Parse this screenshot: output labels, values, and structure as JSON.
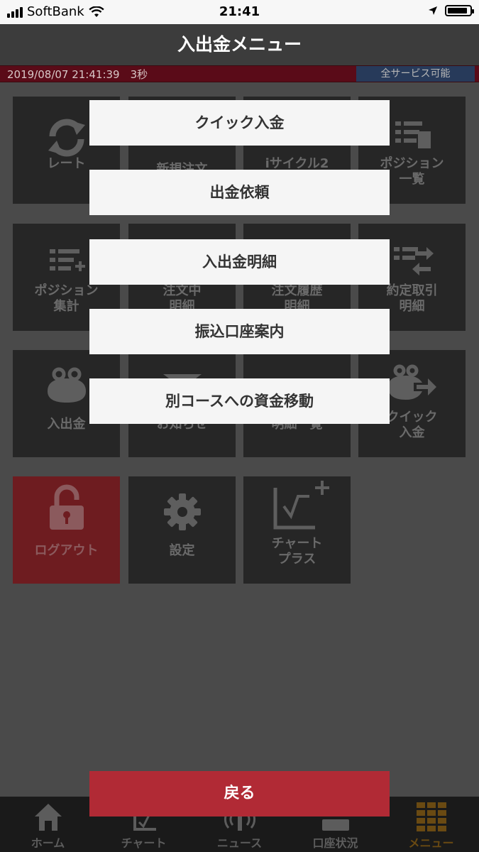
{
  "status_bar": {
    "carrier": "SoftBank",
    "time": "21:41"
  },
  "header": {
    "title": "入出金メニュー"
  },
  "info_bar": {
    "timestamp": "2019/08/07 21:41:39　3秒",
    "service_status": "全サービス可能"
  },
  "menu_grid": {
    "tiles": [
      {
        "label": "レート",
        "icon": "refresh-icon"
      },
      {
        "label": "新規注文",
        "icon": "order-icon"
      },
      {
        "label": "iサイクル2",
        "icon": "cycle-icon"
      },
      {
        "label": "ポジション\n一覧",
        "icon": "position-list-icon"
      },
      {
        "label": "ポジション\n集計",
        "icon": "position-summary-icon"
      },
      {
        "label": "注文中\n明細",
        "icon": "pending-order-icon"
      },
      {
        "label": "注文履歴\n明細",
        "icon": "order-history-icon"
      },
      {
        "label": "約定取引\n明細",
        "icon": "trade-detail-icon"
      },
      {
        "label": "入出金",
        "icon": "purse-icon"
      },
      {
        "label": "お知らせ",
        "icon": "envelope-icon"
      },
      {
        "label": "明細一覧",
        "icon": "detail-list-icon"
      },
      {
        "label": "クイック\n入金",
        "icon": "quick-deposit-icon"
      },
      {
        "label": "ログアウト",
        "icon": "lock-icon"
      },
      {
        "label": "設定",
        "icon": "gear-icon"
      },
      {
        "label": "チャート\nプラス",
        "icon": "chart-plus-icon"
      }
    ]
  },
  "popup_menu": {
    "items": [
      "クイック入金",
      "出金依頼",
      "入出金明細",
      "振込口座案内",
      "別コースへの資金移動"
    ],
    "back_label": "戻る"
  },
  "tab_bar": {
    "tabs": [
      {
        "label": "ホーム",
        "icon": "home-icon"
      },
      {
        "label": "チャート",
        "icon": "chart-icon"
      },
      {
        "label": "ニュース",
        "icon": "news-icon"
      },
      {
        "label": "口座状況",
        "icon": "account-icon"
      },
      {
        "label": "メニュー",
        "icon": "menu-grid-icon"
      }
    ],
    "active_index": 4
  },
  "colors": {
    "accent_red": "#b12a35",
    "menu_active": "#6a4a12",
    "title_bar": "#3c3c3c"
  }
}
